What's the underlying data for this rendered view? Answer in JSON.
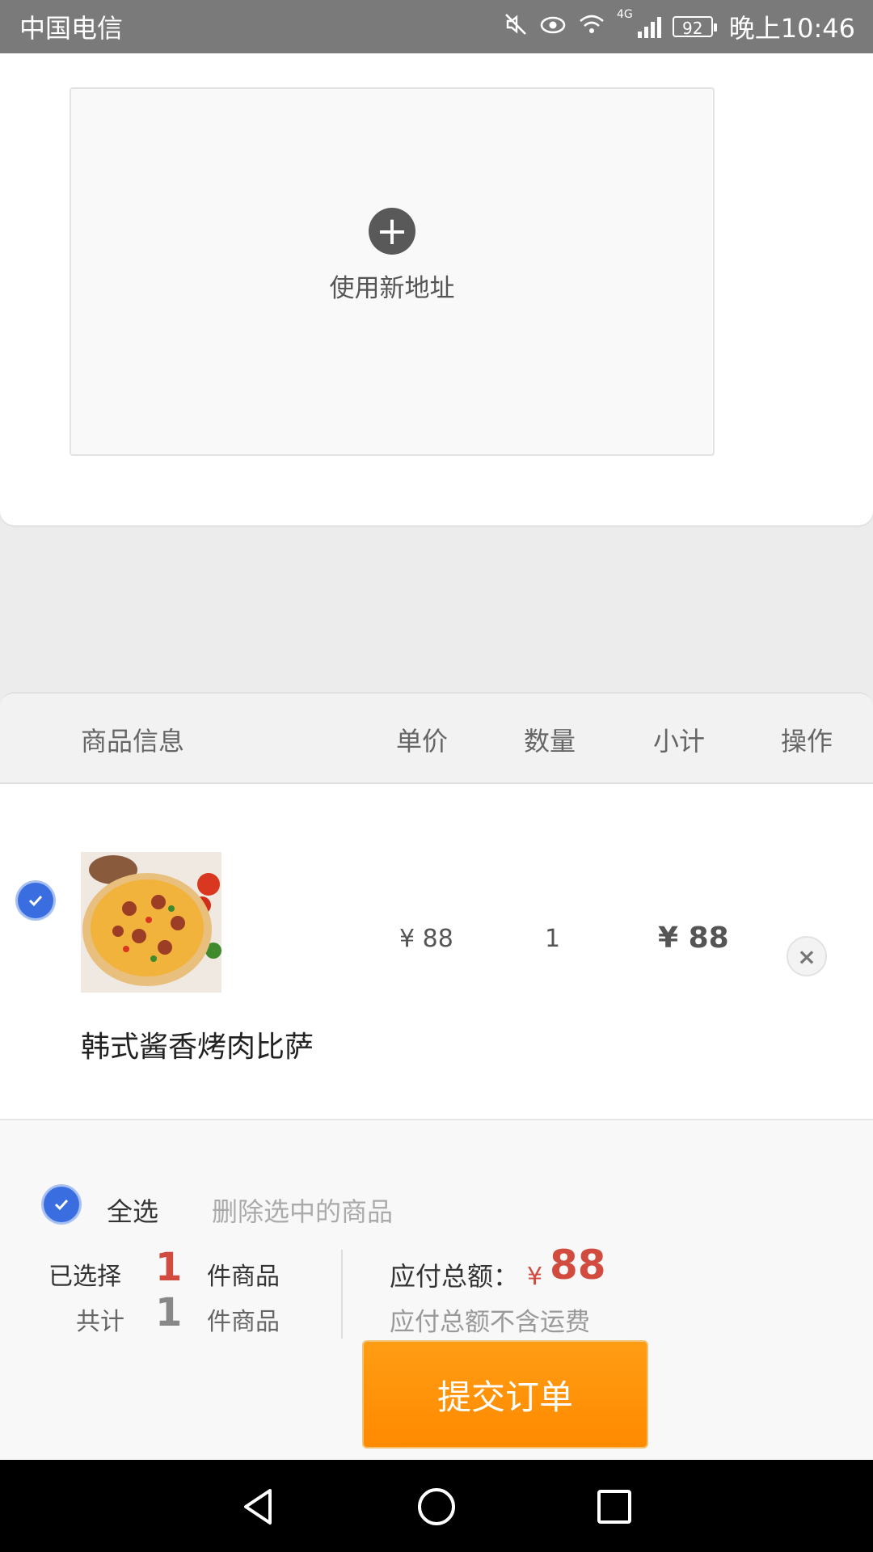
{
  "status_bar": {
    "carrier": "中国电信",
    "battery": "92",
    "time": "晚上10:46",
    "icons": [
      "mute-icon",
      "eye-icon",
      "wifi-icon",
      "4g-icon",
      "signal-icon",
      "battery-icon"
    ]
  },
  "address": {
    "new_address_label": "使用新地址"
  },
  "cart": {
    "headers": {
      "info": "商品信息",
      "unit_price": "单价",
      "quantity": "数量",
      "subtotal": "小计",
      "action": "操作"
    },
    "items": [
      {
        "name": "韩式酱香烤肉比萨",
        "unit_price": "¥ 88",
        "quantity": "1",
        "subtotal": "¥ 88",
        "checked": true
      }
    ],
    "select_all_label": "全选",
    "delete_selected_label": "删除选中的商品",
    "selected_label": "已选择",
    "selected_count": "1",
    "selected_unit": "件商品",
    "total_label_prefix": "共计",
    "total_count": "1",
    "total_unit": "件商品",
    "amount_label": "应付总额：",
    "amount_currency": "¥",
    "amount_value": "88",
    "amount_note": "应付总额不含运费",
    "submit_label": "提交订单"
  },
  "colors": {
    "accent_red": "#d14b3f",
    "submit_orange": "#ff9300",
    "check_blue": "#3a6ee0"
  }
}
